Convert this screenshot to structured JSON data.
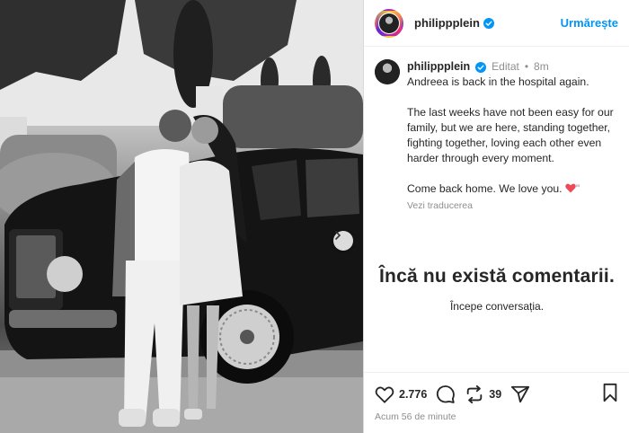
{
  "post": {
    "username": "philippplein",
    "follow_label": "Urmărește",
    "caption": {
      "edited_label": "Editat",
      "time_ago": "8m",
      "line1": "Andreea is back in the hospital again.",
      "para2": "The last weeks have not been easy for our family, but we are here, standing together, fighting together, loving each other even harder through every moment.",
      "para3": "Come back home. We love you. ",
      "translate_label": "Vezi traducerea"
    },
    "comments": {
      "empty_title": "Încă nu există comentarii.",
      "empty_sub": "Începe conversația."
    },
    "stats": {
      "likes": "2.776",
      "shares": "39"
    },
    "posted_ago": "Acum 56 de minute"
  },
  "colors": {
    "accent": "#0095f6",
    "heart": "#ed4956",
    "verified": "#0095f6"
  },
  "icons": {
    "like": "heart-icon",
    "comment": "comment-icon",
    "repost": "repost-icon",
    "share": "share-icon",
    "save": "bookmark-icon",
    "next": "chevron-right-icon"
  }
}
